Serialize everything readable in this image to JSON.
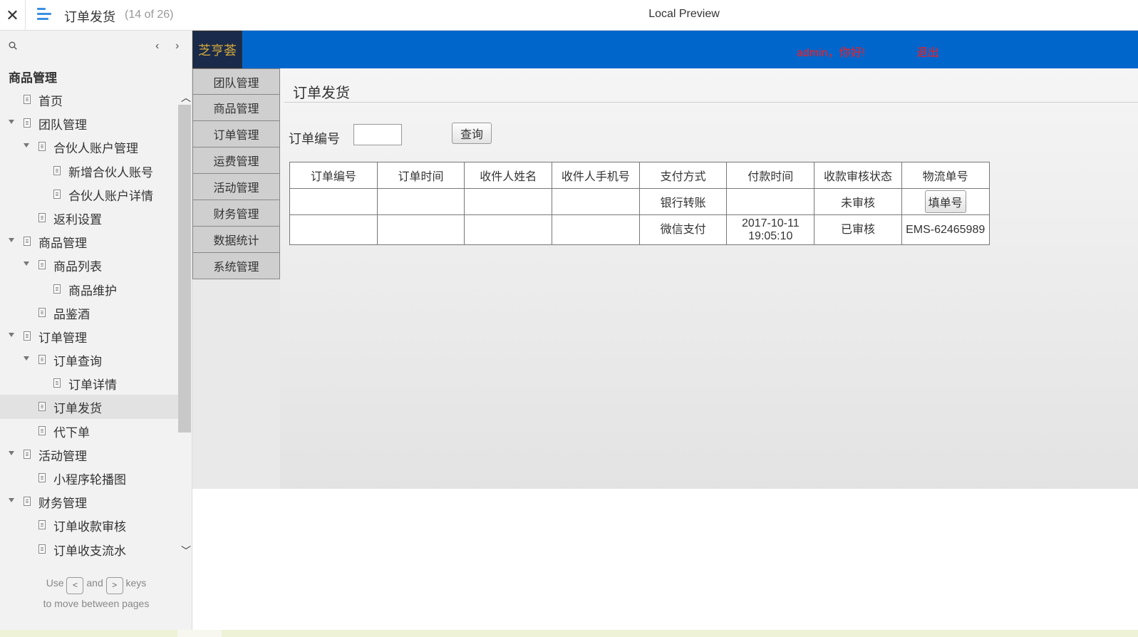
{
  "topbar": {
    "close_glyph": "✕",
    "page_title": "订单发货",
    "page_count": "(14 of 26)",
    "preview_title": "Local Preview"
  },
  "sidebar": {
    "heading": "商品管理",
    "prev_glyph": "‹",
    "next_glyph": "›",
    "items": [
      {
        "label": "首页",
        "level": 1,
        "caret": false,
        "selected": false
      },
      {
        "label": "团队管理",
        "level": 1,
        "caret": true,
        "selected": false
      },
      {
        "label": "合伙人账户管理",
        "level": 2,
        "caret": true,
        "selected": false
      },
      {
        "label": "新增合伙人账号",
        "level": 3,
        "caret": false,
        "selected": false
      },
      {
        "label": "合伙人账户详情",
        "level": 3,
        "caret": false,
        "selected": false
      },
      {
        "label": "返利设置",
        "level": 2,
        "caret": false,
        "selected": false
      },
      {
        "label": "商品管理",
        "level": 1,
        "caret": true,
        "selected": false
      },
      {
        "label": "商品列表",
        "level": 2,
        "caret": true,
        "selected": false
      },
      {
        "label": "商品维护",
        "level": 3,
        "caret": false,
        "selected": false
      },
      {
        "label": "品鉴酒",
        "level": 2,
        "caret": false,
        "selected": false
      },
      {
        "label": "订单管理",
        "level": 1,
        "caret": true,
        "selected": false
      },
      {
        "label": "订单查询",
        "level": 2,
        "caret": true,
        "selected": false
      },
      {
        "label": "订单详情",
        "level": 3,
        "caret": false,
        "selected": false
      },
      {
        "label": "订单发货",
        "level": 2,
        "caret": false,
        "selected": true
      },
      {
        "label": "代下单",
        "level": 2,
        "caret": false,
        "selected": false
      },
      {
        "label": "活动管理",
        "level": 1,
        "caret": true,
        "selected": false
      },
      {
        "label": "小程序轮播图",
        "level": 2,
        "caret": false,
        "selected": false
      },
      {
        "label": "财务管理",
        "level": 1,
        "caret": true,
        "selected": false
      },
      {
        "label": "订单收款审核",
        "level": 2,
        "caret": false,
        "selected": false
      },
      {
        "label": "订单收支流水",
        "level": 2,
        "caret": false,
        "selected": false
      }
    ],
    "hint_use": "Use",
    "hint_key_prev": "<",
    "hint_and": "and",
    "hint_key_next": ">",
    "hint_keys": "keys",
    "hint_line2": "to move between pages"
  },
  "app": {
    "logo_text": "芝亨荟",
    "greeting": "admin，你好!",
    "logout": "退出",
    "menu": [
      "团队管理",
      "商品管理",
      "订单管理",
      "运费管理",
      "活动管理",
      "财务管理",
      "数据统计",
      "系统管理"
    ],
    "content_title": "订单发货",
    "query_label": "订单编号",
    "query_value": "",
    "query_button": "查询",
    "table": {
      "headers": [
        "订单编号",
        "订单时间",
        "收件人姓名",
        "收件人手机号",
        "支付方式",
        "付款时间",
        "收款审核状态",
        "物流单号"
      ],
      "rows": [
        [
          "",
          "",
          "",
          "",
          "银行转账",
          "",
          "未审核",
          ""
        ],
        [
          "",
          "",
          "",
          "",
          "微信支付",
          "2017-10-11 19:05:10",
          "已审核",
          "EMS-62465989"
        ]
      ],
      "fill_button": "填单号"
    }
  },
  "colors": {
    "header_blue": "#0066cc",
    "greeting_red": "#ff1a1a",
    "accent_blue": "#3b8fe0"
  }
}
